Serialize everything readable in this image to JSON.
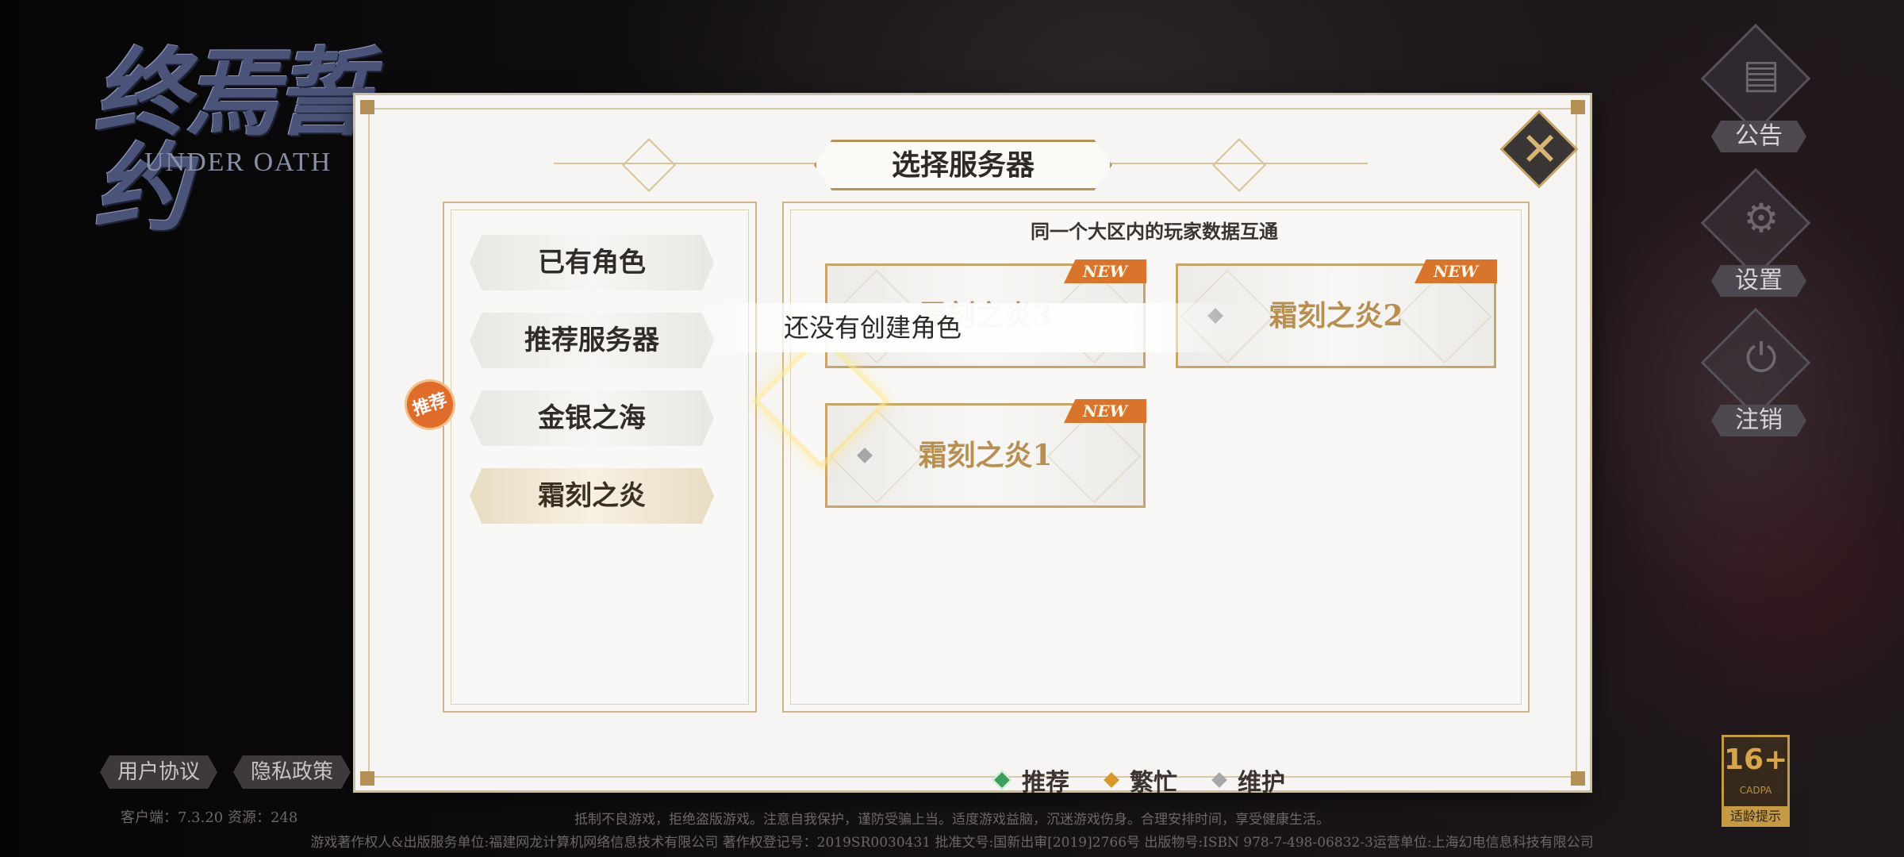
{
  "logo": {
    "title": "终焉誓约",
    "subtitle": "UNDER OATH"
  },
  "side_menu": [
    {
      "label": "公告",
      "icon": "notice-icon"
    },
    {
      "label": "设置",
      "icon": "gear-icon"
    },
    {
      "label": "注销",
      "icon": "power-icon"
    }
  ],
  "dialog": {
    "title": "选择服务器",
    "subtitle": "同一个大区内的玩家数据互通",
    "tabs": [
      {
        "label": "已有角色"
      },
      {
        "label": "推荐服务器"
      },
      {
        "label": "金银之海",
        "badge": "推荐"
      },
      {
        "label": "霜刻之炎"
      }
    ],
    "servers": [
      {
        "name": "霜刻之炎3",
        "tag": "NEW"
      },
      {
        "name": "霜刻之炎2",
        "tag": "NEW"
      },
      {
        "name": "霜刻之炎1",
        "tag": "NEW"
      }
    ],
    "toast": "还没有创建角色",
    "legend": [
      {
        "label": "推荐",
        "color": "#3aa05a"
      },
      {
        "label": "繁忙",
        "color": "#d9962c"
      },
      {
        "label": "维护",
        "color": "#a7a7a7"
      }
    ]
  },
  "bottom": {
    "user_agreement": "用户协议",
    "privacy_policy": "隐私政策",
    "version": "客户端：7.3.20  资源：248",
    "notice_line1": "抵制不良游戏，拒绝盗版游戏。注意自我保护，谨防受骗上当。适度游戏益脑，沉迷游戏伤身。合理安排时间，享受健康生活。",
    "notice_line2": "游戏著作权人&出版服务单位:福建网龙计算机网络信息技术有限公司  著作权登记号：2019SR0030431  批准文号:国新出审[2019]2766号  出版物号:ISBN 978-7-498-06832-3运营单位:上海幻电信息科技有限公司",
    "age_rating": "16+",
    "age_cadpa": "CADPA",
    "age_hint": "适龄提示"
  }
}
